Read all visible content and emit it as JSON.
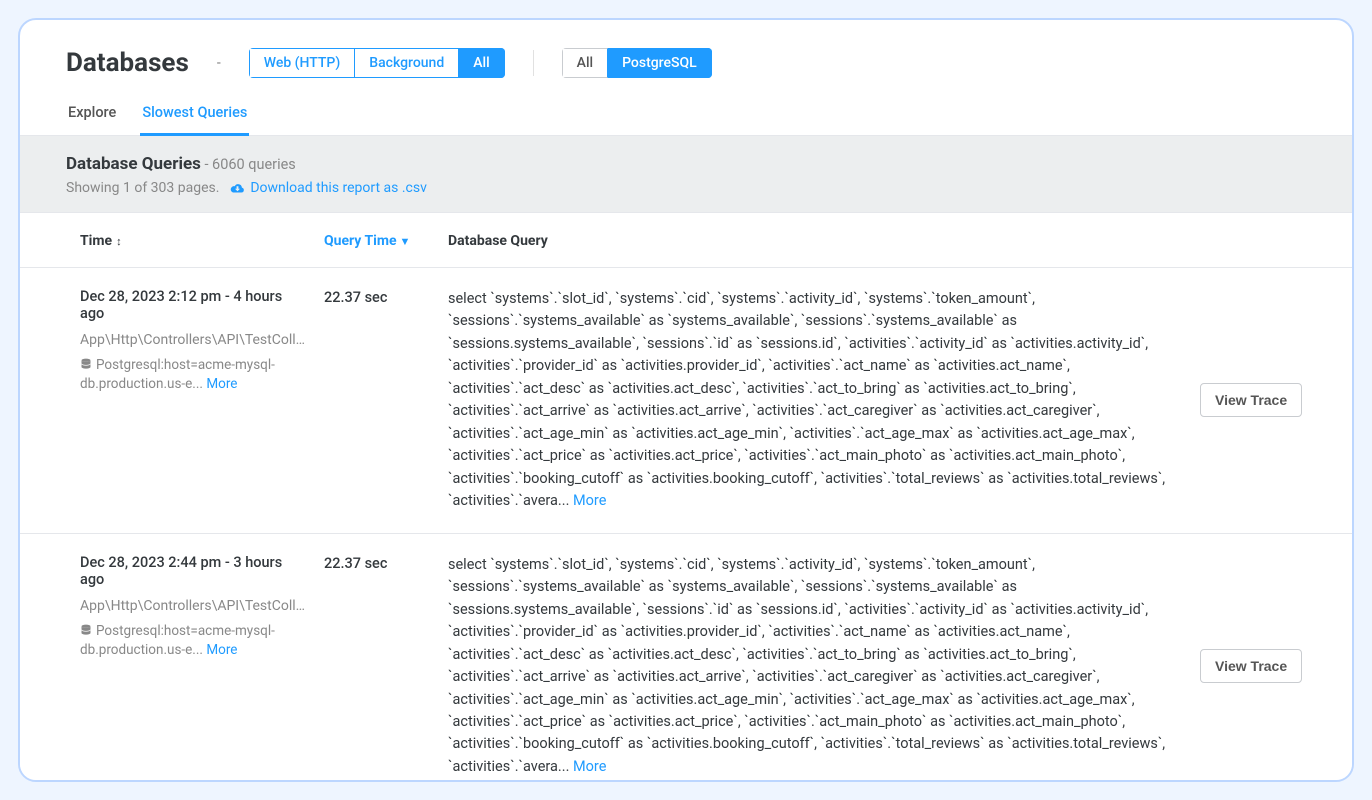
{
  "header": {
    "title": "Databases",
    "dash": "-",
    "filter_group_1": {
      "web": "Web (HTTP)",
      "background": "Background",
      "all": "All"
    },
    "filter_group_2": {
      "all": "All",
      "postgresql": "PostgreSQL"
    }
  },
  "tabs": {
    "explore": "Explore",
    "slowest": "Slowest Queries"
  },
  "content_head": {
    "title": "Database Queries",
    "count_suffix": " - 6060 queries",
    "showing": "Showing 1 of 303 pages.",
    "download": "Download this report as .csv"
  },
  "columns": {
    "time": "Time",
    "query_time": "Query Time",
    "database_query": "Database Query"
  },
  "actions": {
    "view_trace": "View Trace",
    "more": "More"
  },
  "rows": [
    {
      "timestamp": "Dec 28, 2023 2:12 pm - 4 hours ago",
      "controller": "App\\Http\\Controllers\\API\\TestCollectorC…",
      "db_line_prefix": "Postgresql:host=acme-mysql-db.production.us-e... ",
      "query_time": "22.37 sec",
      "query_text": "select `systems`.`slot_id`, `systems`.`cid`, `systems`.`activity_id`, `systems`.`token_amount`, `sessions`.`systems_available` as `systems_available`, `sessions`.`systems_available` as `sessions.systems_available`, `sessions`.`id` as `sessions.id`, `activities`.`activity_id` as `activities.activity_id`, `activities`.`provider_id` as `activities.provider_id`, `activities`.`act_name` as `activities.act_name`, `activities`.`act_desc` as `activities.act_desc`, `activities`.`act_to_bring` as `activities.act_to_bring`, `activities`.`act_arrive` as `activities.act_arrive`, `activities`.`act_caregiver` as `activities.act_caregiver`, `activities`.`act_age_min` as `activities.act_age_min`, `activities`.`act_age_max` as `activities.act_age_max`, `activities`.`act_price` as `activities.act_price`, `activities`.`act_main_photo` as `activities.act_main_photo`, `activities`.`booking_cutoff` as `activities.booking_cutoff`, `activities`.`total_reviews` as `activities.total_reviews`, `activities`.`avera... "
    },
    {
      "timestamp": "Dec 28, 2023 2:44 pm - 3 hours ago",
      "controller": "App\\Http\\Controllers\\API\\TestCollectorC…",
      "db_line_prefix": "Postgresql:host=acme-mysql-db.production.us-e... ",
      "query_time": "22.37 sec",
      "query_text": "select `systems`.`slot_id`, `systems`.`cid`, `systems`.`activity_id`, `systems`.`token_amount`, `sessions`.`systems_available` as `systems_available`, `sessions`.`systems_available` as `sessions.systems_available`, `sessions`.`id` as `sessions.id`, `activities`.`activity_id` as `activities.activity_id`, `activities`.`provider_id` as `activities.provider_id`, `activities`.`act_name` as `activities.act_name`, `activities`.`act_desc` as `activities.act_desc`, `activities`.`act_to_bring` as `activities.act_to_bring`, `activities`.`act_arrive` as `activities.act_arrive`, `activities`.`act_caregiver` as `activities.act_caregiver`, `activities`.`act_age_min` as `activities.act_age_min`, `activities`.`act_age_max` as `activities.act_age_max`, `activities`.`act_price` as `activities.act_price`, `activities`.`act_main_photo` as `activities.act_main_photo`, `activities`.`booking_cutoff` as `activities.booking_cutoff`, `activities`.`total_reviews` as `activities.total_reviews`, `activities`.`avera... "
    }
  ]
}
